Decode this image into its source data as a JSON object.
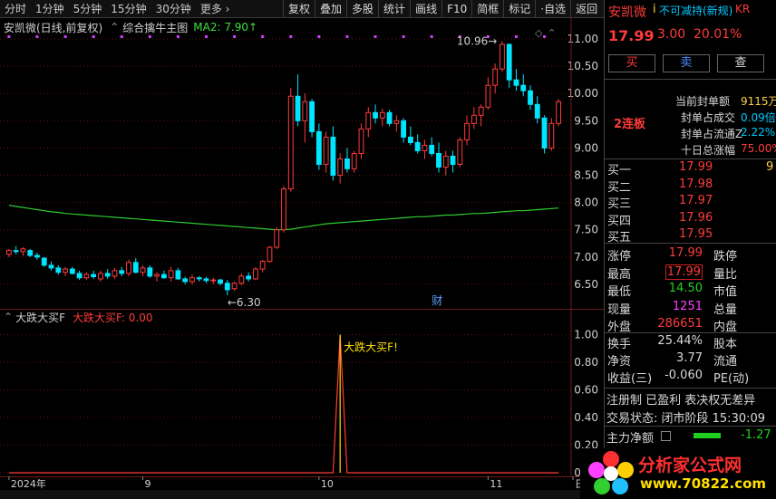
{
  "toolbar": {
    "periods": [
      "分时",
      "1分钟",
      "5分钟",
      "15分钟",
      "30分钟",
      "更多 ›"
    ],
    "tools": [
      "复权",
      "叠加",
      "多股",
      "统计",
      "画线",
      "F10",
      "简框",
      "标记",
      "·自选",
      "返回"
    ]
  },
  "main_header": {
    "symbol": "安凯微(日线,前复权)",
    "ctrl": "⌃",
    "indicator": "综合擒牛主图",
    "ma_label": "MA2: 7.90↑"
  },
  "sub_header": {
    "ctrl": "⌃",
    "name": "大跌大买F",
    "value_label": "大跌大买F: 0.00"
  },
  "colors": {
    "up": "#ff3b3b",
    "down": "#00e5ff",
    "ma": "#2ecc2e",
    "grid": "#5a1414",
    "axis_text": "#d0d0d0",
    "signal": "#ffe000"
  },
  "chart_data": [
    {
      "type": "candlestick",
      "title": "安凯微(日线,前复权)",
      "ylim": [
        6.2,
        11.25
      ],
      "yticks": [
        6.5,
        7.0,
        7.5,
        8.0,
        8.5,
        9.0,
        9.5,
        10.0,
        10.5,
        11.0
      ],
      "xlabels": [
        {
          "label": "2024年",
          "index": 0
        },
        {
          "label": "9",
          "index": 19
        },
        {
          "label": "10",
          "index": 44
        },
        {
          "label": "11",
          "index": 68
        },
        {
          "label": "日线",
          "index": 88
        }
      ],
      "candles": [
        [
          7.05,
          7.15,
          7.0,
          7.12
        ],
        [
          7.12,
          7.2,
          7.05,
          7.1
        ],
        [
          7.1,
          7.18,
          7.02,
          7.15
        ],
        [
          7.12,
          7.15,
          7.0,
          7.03
        ],
        [
          7.03,
          7.08,
          6.95,
          7.0
        ],
        [
          6.98,
          7.0,
          6.82,
          6.85
        ],
        [
          6.85,
          6.92,
          6.75,
          6.8
        ],
        [
          6.8,
          6.85,
          6.68,
          6.72
        ],
        [
          6.72,
          6.82,
          6.65,
          6.78
        ],
        [
          6.78,
          6.82,
          6.68,
          6.7
        ],
        [
          6.7,
          6.75,
          6.58,
          6.62
        ],
        [
          6.62,
          6.72,
          6.58,
          6.68
        ],
        [
          6.68,
          6.75,
          6.6,
          6.64
        ],
        [
          6.6,
          6.75,
          6.55,
          6.7
        ],
        [
          6.7,
          6.78,
          6.6,
          6.65
        ],
        [
          6.65,
          6.8,
          6.6,
          6.75
        ],
        [
          6.75,
          6.82,
          6.65,
          6.7
        ],
        [
          6.7,
          6.95,
          6.65,
          6.9
        ],
        [
          6.9,
          6.98,
          6.7,
          6.72
        ],
        [
          6.72,
          6.85,
          6.65,
          6.8
        ],
        [
          6.8,
          6.85,
          6.62,
          6.65
        ],
        [
          6.65,
          6.72,
          6.55,
          6.68
        ],
        [
          6.68,
          6.75,
          6.6,
          6.62
        ],
        [
          6.62,
          6.82,
          6.55,
          6.75
        ],
        [
          6.75,
          6.8,
          6.58,
          6.6
        ],
        [
          6.6,
          6.64,
          6.5,
          6.55
        ],
        [
          6.55,
          6.68,
          6.5,
          6.62
        ],
        [
          6.62,
          6.65,
          6.55,
          6.6
        ],
        [
          6.6,
          6.64,
          6.52,
          6.57
        ],
        [
          6.57,
          6.62,
          6.5,
          6.58
        ],
        [
          6.58,
          6.6,
          6.48,
          6.52
        ],
        [
          6.52,
          6.58,
          6.3,
          6.4
        ],
        [
          6.42,
          6.55,
          6.38,
          6.52
        ],
        [
          6.52,
          6.7,
          6.48,
          6.65
        ],
        [
          6.65,
          6.72,
          6.55,
          6.6
        ],
        [
          6.6,
          6.82,
          6.58,
          6.78
        ],
        [
          6.78,
          6.95,
          6.72,
          6.92
        ],
        [
          6.92,
          7.2,
          6.9,
          7.18
        ],
        [
          7.18,
          7.55,
          7.15,
          7.5
        ],
        [
          7.5,
          8.3,
          7.45,
          8.25
        ],
        [
          8.25,
          10.1,
          8.2,
          9.95
        ],
        [
          9.95,
          10.35,
          9.4,
          9.5
        ],
        [
          9.5,
          10.0,
          9.1,
          9.85
        ],
        [
          9.85,
          9.9,
          9.2,
          9.3
        ],
        [
          9.3,
          9.45,
          8.6,
          8.7
        ],
        [
          8.7,
          9.3,
          8.55,
          9.2
        ],
        [
          9.2,
          9.4,
          8.4,
          8.5
        ],
        [
          8.5,
          8.9,
          8.35,
          8.8
        ],
        [
          8.8,
          9.0,
          8.55,
          8.62
        ],
        [
          8.62,
          8.95,
          8.55,
          8.9
        ],
        [
          8.9,
          9.45,
          8.8,
          9.35
        ],
        [
          9.35,
          9.75,
          9.2,
          9.65
        ],
        [
          9.65,
          9.8,
          9.45,
          9.55
        ],
        [
          9.55,
          9.72,
          9.4,
          9.65
        ],
        [
          9.65,
          9.7,
          9.4,
          9.45
        ],
        [
          9.45,
          9.6,
          9.3,
          9.5
        ],
        [
          9.5,
          9.55,
          9.1,
          9.2
        ],
        [
          9.2,
          9.4,
          9.05,
          9.1
        ],
        [
          9.1,
          9.25,
          8.9,
          8.95
        ],
        [
          8.95,
          9.15,
          8.8,
          9.05
        ],
        [
          9.05,
          9.2,
          8.85,
          8.9
        ],
        [
          8.9,
          9.1,
          8.55,
          8.65
        ],
        [
          8.65,
          8.95,
          8.5,
          8.85
        ],
        [
          8.85,
          8.95,
          8.55,
          8.7
        ],
        [
          8.7,
          9.2,
          8.65,
          9.15
        ],
        [
          9.15,
          9.6,
          9.05,
          9.45
        ],
        [
          9.45,
          9.75,
          9.35,
          9.6
        ],
        [
          9.6,
          9.8,
          9.4,
          9.75
        ],
        [
          9.75,
          10.3,
          9.7,
          10.15
        ],
        [
          10.15,
          10.55,
          10.0,
          10.45
        ],
        [
          10.45,
          10.96,
          10.4,
          10.9
        ],
        [
          10.9,
          10.92,
          10.1,
          10.25
        ],
        [
          10.25,
          10.45,
          10.05,
          10.15
        ],
        [
          10.15,
          10.35,
          9.95,
          10.05
        ],
        [
          10.05,
          10.15,
          9.7,
          9.8
        ],
        [
          9.8,
          9.95,
          9.45,
          9.55
        ],
        [
          9.55,
          9.6,
          8.9,
          9.0
        ],
        [
          9.0,
          9.55,
          8.95,
          9.45
        ],
        [
          9.45,
          9.9,
          9.4,
          9.85
        ]
      ],
      "ma_series": {
        "name": "MA2",
        "values": [
          7.95,
          7.93,
          7.91,
          7.89,
          7.87,
          7.85,
          7.83,
          7.82,
          7.8,
          7.79,
          7.78,
          7.77,
          7.76,
          7.75,
          7.74,
          7.73,
          7.72,
          7.71,
          7.7,
          7.69,
          7.68,
          7.67,
          7.66,
          7.65,
          7.64,
          7.63,
          7.62,
          7.61,
          7.6,
          7.59,
          7.58,
          7.57,
          7.56,
          7.55,
          7.54,
          7.53,
          7.52,
          7.51,
          7.5,
          7.5,
          7.51,
          7.53,
          7.55,
          7.57,
          7.59,
          7.61,
          7.62,
          7.63,
          7.64,
          7.65,
          7.66,
          7.67,
          7.68,
          7.69,
          7.7,
          7.71,
          7.72,
          7.73,
          7.74,
          7.74,
          7.75,
          7.76,
          7.77,
          7.77,
          7.78,
          7.79,
          7.8,
          7.8,
          7.81,
          7.82,
          7.83,
          7.84,
          7.85,
          7.85,
          7.86,
          7.87,
          7.88,
          7.89,
          7.9
        ]
      },
      "annotations": [
        {
          "text": "10.96",
          "index": 70,
          "price": 10.96
        },
        {
          "text": "6.30",
          "index": 31,
          "price": 6.3
        },
        {
          "text": "财",
          "index": 60,
          "price": 6.3
        }
      ]
    },
    {
      "type": "line",
      "title": "大跌大买F",
      "ylim": [
        0,
        1.05
      ],
      "yticks": [
        0.0,
        0.2,
        0.4,
        0.6,
        0.8,
        1.0
      ],
      "signal_label": "大跌大买F!",
      "signal_index": 47,
      "values": [
        0,
        0,
        0,
        0,
        0,
        0,
        0,
        0,
        0,
        0,
        0,
        0,
        0,
        0,
        0,
        0,
        0,
        0,
        0,
        0,
        0,
        0,
        0,
        0,
        0,
        0,
        0,
        0,
        0,
        0,
        0,
        0,
        0,
        0,
        0,
        0,
        0,
        0,
        0,
        0,
        0,
        0,
        0,
        0,
        0,
        0,
        0,
        1,
        0,
        0,
        0,
        0,
        0,
        0,
        0,
        0,
        0,
        0,
        0,
        0,
        0,
        0,
        0,
        0,
        0,
        0,
        0,
        0,
        0,
        0,
        0,
        0,
        0,
        0,
        0,
        0,
        0,
        0,
        0
      ]
    }
  ],
  "panel": {
    "title": "安凯微",
    "title_mark": "i",
    "reduction": "不可减持(新规)",
    "kr": "KR",
    "price": "17.99",
    "change": "3.00",
    "pct": "20.01%",
    "buy_label": "买",
    "sell_label": "卖",
    "query_label": "查",
    "streak": "2连板",
    "seal_info": [
      {
        "label": "当前封单额",
        "value": "9115万"
      },
      {
        "label": "封单占成交",
        "value": "0.09倍"
      },
      {
        "label": "封单占流通Z",
        "value": "2.22%"
      },
      {
        "label": "十日总涨幅",
        "value": "75.00%"
      }
    ],
    "bids": [
      {
        "label": "买一",
        "price": "17.99",
        "vol": "9"
      },
      {
        "label": "买二",
        "price": "17.98",
        "vol": ""
      },
      {
        "label": "买三",
        "price": "17.97",
        "vol": ""
      },
      {
        "label": "买四",
        "price": "17.96",
        "vol": ""
      },
      {
        "label": "买五",
        "price": "17.95",
        "vol": ""
      }
    ],
    "stats": [
      {
        "l1": "涨停",
        "v1": "17.99",
        "l2": "跌停",
        "c": "cr"
      },
      {
        "l1": "最高",
        "v1": "17.99",
        "l2": "量比",
        "c": "cr"
      },
      {
        "l1": "最低",
        "v1": "14.50",
        "l2": "市值",
        "c": "cg"
      },
      {
        "l1": "现量",
        "v1": "1251",
        "l2": "总量",
        "c": "cm"
      },
      {
        "l1": "外盘",
        "v1": "286651",
        "l2": "内盘",
        "c": "cr"
      }
    ],
    "fund": [
      {
        "l1": "换手",
        "v1": "25.44%",
        "l2": "股本"
      },
      {
        "l1": "净资",
        "v1": "3.77",
        "l2": "流通"
      },
      {
        "l1": "收益(三)",
        "v1": "-0.060",
        "l2": "PE(动)"
      }
    ],
    "reg_line": "注册制  已盈利  表决权无差异",
    "status_line": "交易状态: 闭市阶段 15:30:09",
    "main_net_label": "主力净额",
    "main_net_value": "-1.27"
  },
  "logo": {
    "text": "分析家公式网",
    "url": "www.70822.com"
  }
}
